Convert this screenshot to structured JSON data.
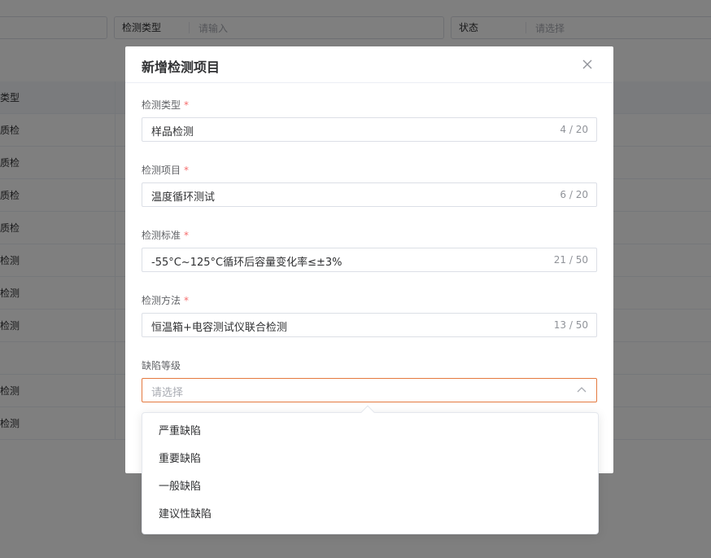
{
  "filters": [
    {
      "label": "",
      "placeholder": ""
    },
    {
      "label": "检测类型",
      "placeholder": "请输入"
    },
    {
      "label": "状态",
      "placeholder": "请选择"
    }
  ],
  "table": {
    "header": "类型",
    "rows": [
      "质检",
      "质检",
      "质检",
      "质检",
      "检测",
      "检测",
      "检测",
      "",
      "检测",
      "检测"
    ]
  },
  "dialog": {
    "title": "新增检测项目",
    "fields": [
      {
        "label": "检测类型",
        "required": "*",
        "value": "样品检测",
        "count": "4 / 20"
      },
      {
        "label": "检测项目",
        "required": "*",
        "value": "温度循环测试",
        "count": "6 / 20"
      },
      {
        "label": "检测标准",
        "required": "*",
        "value": "-55°C~125°C循环后容量变化率≤±3%",
        "count": "21 / 50"
      },
      {
        "label": "检测方法",
        "required": "*",
        "value": "恒温箱+电容测试仪联合检测",
        "count": "13 / 50"
      }
    ],
    "defect": {
      "label": "缺陷等级",
      "placeholder": "请选择"
    }
  },
  "dropdown": {
    "options": [
      "严重缺陷",
      "重要缺陷",
      "一般缺陷",
      "建议性缺陷"
    ]
  },
  "colors": {
    "accent": "#e4793f",
    "required": "#f56c6c"
  }
}
